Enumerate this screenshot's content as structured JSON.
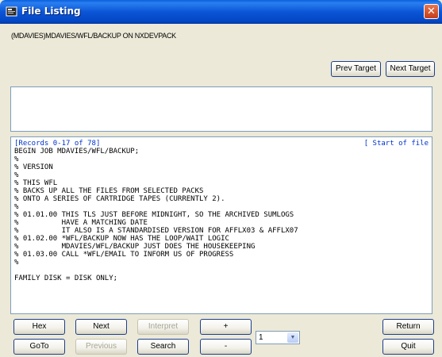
{
  "window": {
    "title": "File Listing",
    "close_glyph": "✕"
  },
  "path": "(MDAVIES)MDAVIES/WFL/BACKUP ON NXDEVPACK",
  "targets": {
    "prev": "Prev Target",
    "next": "Next Target"
  },
  "listing": {
    "records": "[Records 0-17 of 78]",
    "position": "[ Start of file",
    "lines": [
      "BEGIN JOB MDAVIES/WFL/BACKUP;",
      "%",
      "% VERSION",
      "%",
      "% THIS WFL",
      "% BACKS UP ALL THE FILES FROM SELECTED PACKS",
      "% ONTO A SERIES OF CARTRIDGE TAPES (CURRENTLY 2).",
      "%",
      "% 01.01.00 THIS TLS JUST BEFORE MIDNIGHT, SO THE ARCHIVED SUMLOGS",
      "%          HAVE A MATCHING DATE",
      "%          IT ALSO IS A STANDARDISED VERSION FOR AFFLX03 & AFFLX07",
      "% 01.02.00 *WFL/BACKUP NOW HAS THE LOOP/WAIT LOGIC",
      "%          MDAVIES/WFL/BACKUP JUST DOES THE HOUSEKEEPING",
      "% 01.03.00 CALL *WFL/EMAIL TO INFORM US OF PROGRESS",
      "%",
      "",
      "FAMILY DISK = DISK ONLY;"
    ]
  },
  "buttons": {
    "hex": "Hex",
    "next": "Next",
    "interpret": "Interpret",
    "plus": "+",
    "return": "Return",
    "goto": "GoTo",
    "previous": "Previous",
    "search": "Search",
    "minus": "-",
    "quit": "Quit"
  },
  "step_combo": {
    "value": "1",
    "arrow": "▼"
  }
}
